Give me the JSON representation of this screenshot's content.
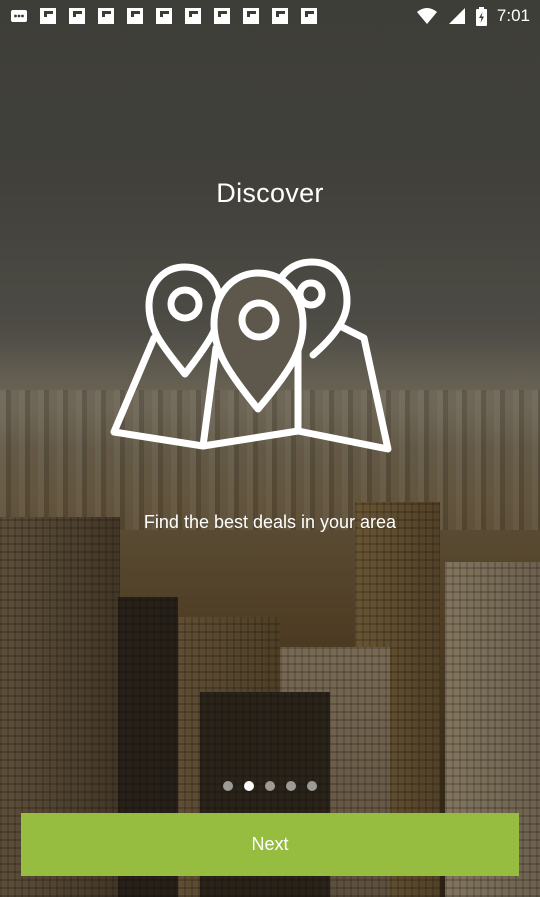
{
  "status_bar": {
    "notification_icons": [
      "chat-icon",
      "flipboard-icon",
      "flipboard-icon",
      "flipboard-icon",
      "flipboard-icon",
      "flipboard-icon",
      "flipboard-icon",
      "flipboard-icon",
      "flipboard-icon",
      "flipboard-icon",
      "flipboard-icon"
    ],
    "time": "7:01"
  },
  "onboarding": {
    "title": "Discover",
    "icon": "map-pins-icon",
    "tagline": "Find the best deals in your area",
    "pages_total": 5,
    "active_page": 2,
    "next_label": "Next"
  },
  "colors": {
    "accent": "#97bd40",
    "text": "#ffffff"
  }
}
